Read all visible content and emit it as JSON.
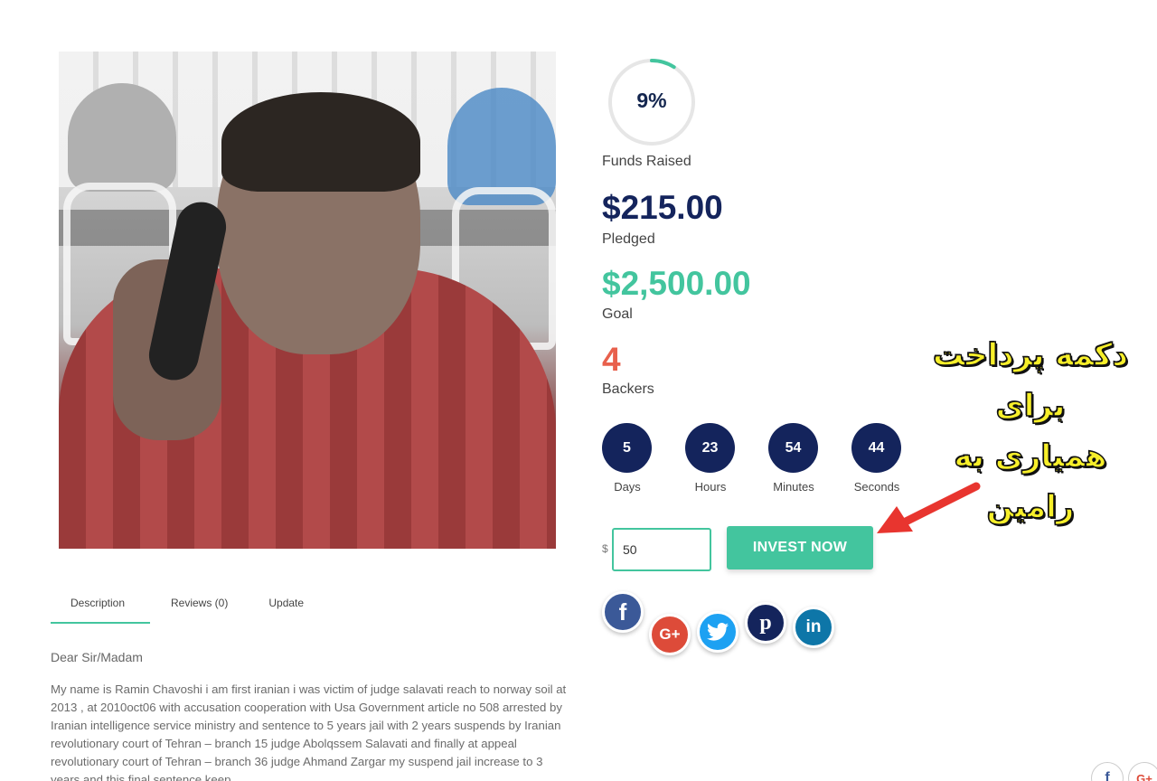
{
  "campaign": {
    "progress_percent": 9,
    "progress_label": "9%",
    "funds_label": "Funds Raised",
    "pledged_value": "$215.00",
    "pledged_label": "Pledged",
    "goal_value": "$2,500.00",
    "goal_label": "Goal",
    "backers_value": "4",
    "backers_label": "Backers"
  },
  "countdown": [
    {
      "value": "5",
      "unit": "Days"
    },
    {
      "value": "23",
      "unit": "Hours"
    },
    {
      "value": "54",
      "unit": "Minutes"
    },
    {
      "value": "44",
      "unit": "Seconds"
    }
  ],
  "invest": {
    "currency_symbol": "$",
    "amount_value": "50",
    "button_label": "INVEST NOW"
  },
  "social": {
    "facebook": "f",
    "google_plus": "G+",
    "twitter": "twitter-icon",
    "pinterest": "p",
    "linkedin": "in"
  },
  "tabs": [
    {
      "label": "Description",
      "active": true
    },
    {
      "label": "Reviews (0)",
      "active": false
    },
    {
      "label": "Update",
      "active": false
    }
  ],
  "description": {
    "greeting": "Dear Sir/Madam",
    "body": "My name is Ramin Chavoshi i am first iranian i was victim of judge salavati reach to norway soil at 2013 ,  at 2010oct06 with accusation cooperation with Usa Government article no 508 arrested by Iranian intelligence service ministry and sentence to 5 years jail with 2 years suspends by Iranian revolutionary court of Tehran – branch 15 judge Abolqssem Salavati and finally at appeal revolutionary court of Tehran – branch 36 judge Ahmand Zargar my suspend jail increase to 3 years and this final sentence keep"
  },
  "annotation": {
    "line1": "دکمه پرداخت",
    "line2": "برای",
    "line3": "همیاری به",
    "line4": "رامین"
  },
  "corner": {
    "fb": "f",
    "gplus": "G+"
  },
  "colors": {
    "navy": "#14245c",
    "accent_green": "#43c59e",
    "backers_red": "#e8604c",
    "annotation_yellow": "#f7ef2a"
  }
}
